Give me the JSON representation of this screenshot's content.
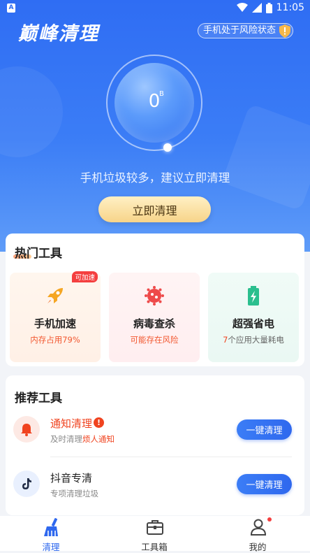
{
  "status_bar": {
    "time": "11:05",
    "app_indicator": "A"
  },
  "header": {
    "app_title": "巅峰清理",
    "risk_badge": "手机处于风险状态"
  },
  "gauge": {
    "value": "0",
    "unit": "B"
  },
  "hint": "手机垃圾较多，建议立即清理",
  "clean_button": "立即清理",
  "hot_tools": {
    "title": "热门工具",
    "items": [
      {
        "name": "手机加速",
        "sub": "内存占用79%",
        "badge": "可加速",
        "icon": "rocket-icon",
        "color": "#f5a623"
      },
      {
        "name": "病毒查杀",
        "sub": "可能存在风险",
        "icon": "virus-icon",
        "color": "#ee4a4a"
      },
      {
        "name": "超强省电",
        "sub_count": "7",
        "sub": "个应用大量耗电",
        "icon": "battery-icon",
        "color": "#2bbf8e"
      }
    ]
  },
  "recommend": {
    "title": "推荐工具",
    "items": [
      {
        "name": "通知清理",
        "desc_prefix": "及时清理",
        "desc_highlight": "烦人通知",
        "button": "一键清理",
        "icon": "bell-icon"
      },
      {
        "name": "抖音专清",
        "desc": "专项清理垃圾",
        "button": "一键清理",
        "icon": "tiktok-icon"
      }
    ]
  },
  "bottom_nav": [
    {
      "label": "清理",
      "icon": "broom-icon",
      "active": true
    },
    {
      "label": "工具箱",
      "icon": "toolbox-icon",
      "active": false
    },
    {
      "label": "我的",
      "icon": "user-icon",
      "active": false
    }
  ],
  "colors": {
    "primary": "#2f68ee",
    "accent_orange": "#f0431f",
    "button_gold": "#f7d489"
  }
}
